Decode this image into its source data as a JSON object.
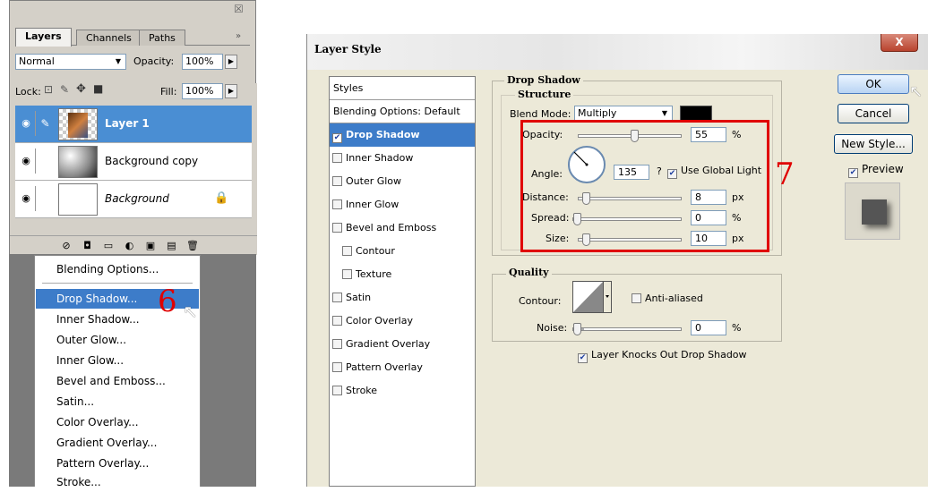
{
  "layers_panel": {
    "tabs": [
      "Layers",
      "Channels",
      "Paths"
    ],
    "blend_mode": "Normal",
    "opacity_label": "Opacity:",
    "opacity_value": "100%",
    "lock_label": "Lock:",
    "fill_label": "Fill:",
    "fill_value": "100%",
    "layers": [
      {
        "name": "Layer 1",
        "selected": true
      },
      {
        "name": "Background copy",
        "selected": false
      },
      {
        "name": "Background",
        "selected": false,
        "italic": true,
        "locked": true
      }
    ]
  },
  "context_menu": {
    "items": [
      "Blending Options...",
      "Drop Shadow...",
      "Inner Shadow...",
      "Outer Glow...",
      "Inner Glow...",
      "Bevel and Emboss...",
      "Satin...",
      "Color Overlay...",
      "Gradient Overlay...",
      "Pattern Overlay...",
      "Stroke..."
    ],
    "highlighted": "Drop Shadow..."
  },
  "annotations": {
    "step6": "6",
    "step7": "7",
    "accent": "#e00000"
  },
  "dialog": {
    "title": "Layer Style",
    "close_label": "X",
    "styles_header": "Styles",
    "blending_options": "Blending Options: Default",
    "style_items": [
      {
        "label": "Drop Shadow",
        "checked": true,
        "selected": true,
        "indent": false
      },
      {
        "label": "Inner Shadow",
        "checked": false,
        "selected": false,
        "indent": false
      },
      {
        "label": "Outer Glow",
        "checked": false,
        "selected": false,
        "indent": false
      },
      {
        "label": "Inner Glow",
        "checked": false,
        "selected": false,
        "indent": false
      },
      {
        "label": "Bevel and Emboss",
        "checked": false,
        "selected": false,
        "indent": false
      },
      {
        "label": "Contour",
        "checked": false,
        "selected": false,
        "indent": true
      },
      {
        "label": "Texture",
        "checked": false,
        "selected": false,
        "indent": true
      },
      {
        "label": "Satin",
        "checked": false,
        "selected": false,
        "indent": false
      },
      {
        "label": "Color Overlay",
        "checked": false,
        "selected": false,
        "indent": false
      },
      {
        "label": "Gradient Overlay",
        "checked": false,
        "selected": false,
        "indent": false
      },
      {
        "label": "Pattern Overlay",
        "checked": false,
        "selected": false,
        "indent": false
      },
      {
        "label": "Stroke",
        "checked": false,
        "selected": false,
        "indent": false
      }
    ],
    "drop_shadow": {
      "title": "Drop Shadow",
      "structure_title": "Structure",
      "blend_mode_label": "Blend Mode:",
      "blend_mode_value": "Multiply",
      "shadow_color": "#000000",
      "opacity_label": "Opacity:",
      "opacity_value": "55",
      "opacity_unit": "%",
      "angle_label": "Angle:",
      "angle_value": "135",
      "angle_unit": "?",
      "use_global_light": "Use Global Light",
      "distance_label": "Distance:",
      "distance_value": "8",
      "distance_unit": "px",
      "spread_label": "Spread:",
      "spread_value": "0",
      "spread_unit": "%",
      "size_label": "Size:",
      "size_value": "10",
      "size_unit": "px"
    },
    "quality": {
      "title": "Quality",
      "contour_label": "Contour:",
      "anti_aliased": "Anti-aliased",
      "noise_label": "Noise:",
      "noise_value": "0",
      "noise_unit": "%"
    },
    "knockout": "Layer Knocks Out Drop Shadow",
    "buttons": {
      "ok": "OK",
      "cancel": "Cancel",
      "new_style": "New Style...",
      "preview": "Preview"
    }
  }
}
